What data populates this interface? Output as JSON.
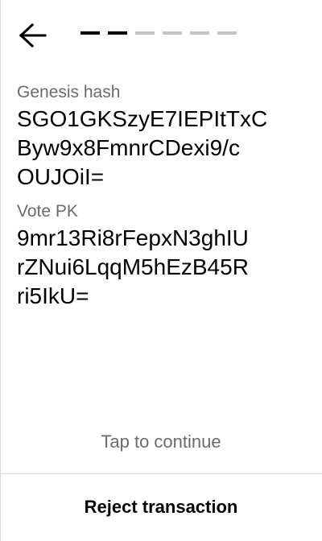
{
  "header": {
    "back_icon": "arrow-left-icon",
    "progress": {
      "total": 6,
      "completed": 2
    }
  },
  "fields": [
    {
      "label": "Genesis hash",
      "value_lines": [
        "SGO1GKSzyE7IEPItTxC",
        "Byw9x8FmnrCDexi9/c",
        "OUJOiI="
      ]
    },
    {
      "label": "Vote PK",
      "value_lines": [
        "9mr13Ri8rFepxN3ghIU",
        "rZNui6LqqM5hEzB45R",
        "ri5IkU="
      ]
    }
  ],
  "footer": {
    "tap_hint": "Tap to continue",
    "reject_label": "Reject transaction"
  }
}
